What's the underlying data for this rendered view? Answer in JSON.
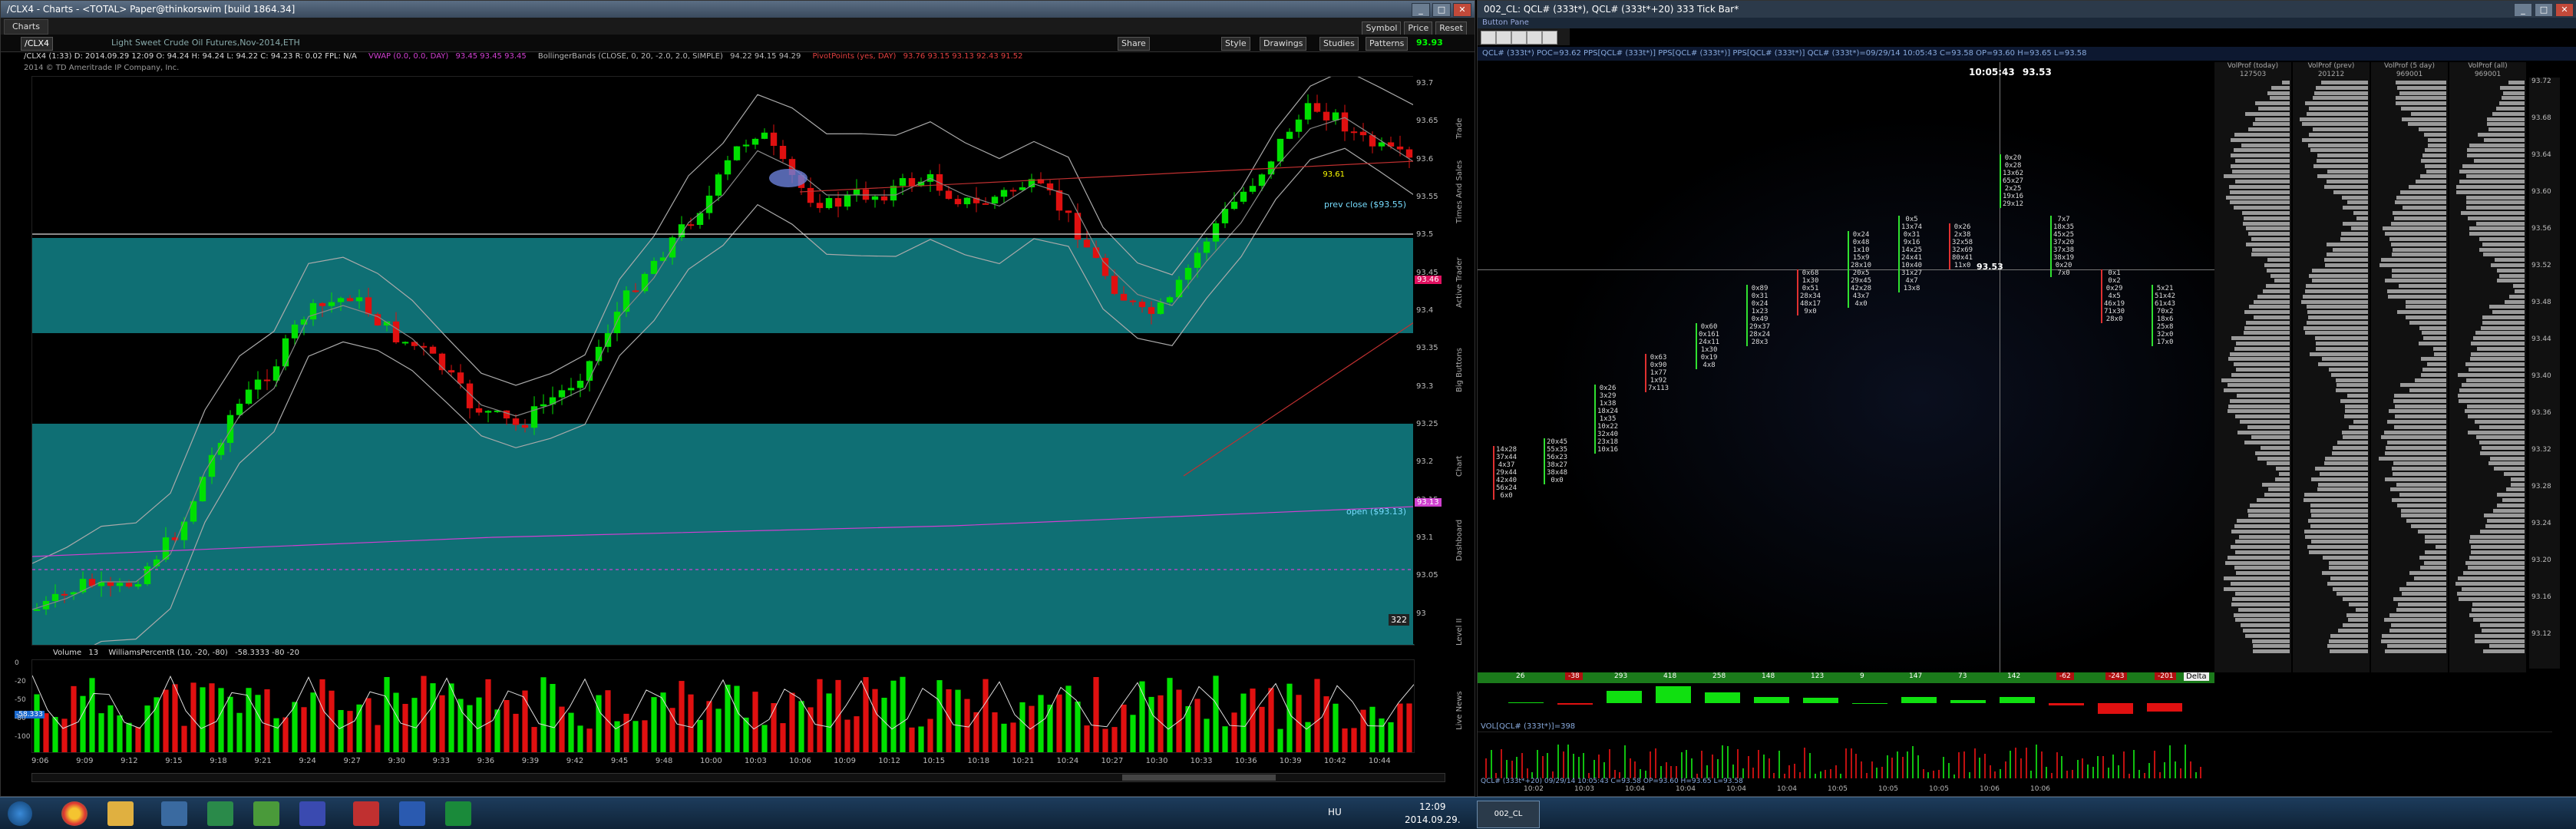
{
  "left_window": {
    "title": "/CLX4 - Charts - <TOTAL> Paper@thinkorswim [build 1864.34]",
    "tab": "Charts",
    "symbol": "/CLX4",
    "symbol_desc": "Light Sweet Crude Oil Futures,Nov-2014,ETH",
    "toolbar": [
      "Share",
      "Style",
      "Drawings",
      "Studies",
      "Patterns"
    ],
    "toolbar_right": [
      "Symbol",
      "Price",
      "Reset"
    ],
    "last_price": "93.93",
    "info_line": "/CLX4 (1:33)  D: 2014.09.29 12:09  O: 94.24  H: 94.24  L: 94.22  C: 94.23  R: 0.02  FPL: N/A",
    "vwap_label": "VWAP (0.0, 0.0, DAY)",
    "vwap_values": "93.45  93.45  93.45",
    "bollinger_label": "BollingerBands (CLOSE, 0, 20, -2.0, 2.0, SIMPLE)",
    "bollinger_values": "94.22  94.15  94.29",
    "pivot_label": "PivotPoints (yes, DAY)",
    "pivot_values": "93.76  93.15  93.13  92.43  91.52",
    "copyright": "2014 © TD Ameritrade IP Company, Inc.",
    "annotations": {
      "prev_close": "prev close ($93.55)",
      "open": "open ($93.13)",
      "bar_count": "322",
      "price_tag": "93.61"
    },
    "y_ticks": [
      "93.7",
      "93.65",
      "93.6",
      "93.55",
      "93.5",
      "93.45",
      "93.4",
      "93.35",
      "93.3",
      "93.25",
      "93.2",
      "93.15",
      "93.1",
      "93.05",
      "93"
    ],
    "right_tags": {
      "tag1": "93.46",
      "tag2": "93.13"
    },
    "side_tabs": [
      "Trade",
      "Times And Sales",
      "Active Trader",
      "Big Buttons",
      "Chart",
      "Dashboard",
      "Level II",
      "Live News"
    ],
    "lower_study": {
      "label": "Volume",
      "value": "13",
      "williams": "WilliamsPercentR (10, -20, -80)",
      "williams_vals": "-58.3333  -80  -20",
      "y_labels": [
        "0",
        "-20",
        "-50",
        "-80",
        "-100"
      ],
      "left_tag": "-58.333"
    },
    "time_ticks": [
      "9:06",
      "9:09",
      "9:12",
      "9:15",
      "9:18",
      "9:21",
      "9:24",
      "9:27",
      "9:30",
      "9:33",
      "9:36",
      "9:39",
      "9:42",
      "9:45",
      "9:48",
      "10:00",
      "10:03",
      "10:06",
      "10:09",
      "10:12",
      "10:15",
      "10:18",
      "10:21",
      "10:24",
      "10:27",
      "10:30",
      "10:33",
      "10:36",
      "10:39",
      "10:42",
      "10:44"
    ],
    "colors": {
      "up": "#00e000",
      "down": "#e01010",
      "band": "#0f6f74",
      "vwap": "#d040d0"
    }
  },
  "right_window": {
    "title": "002_CL: QCL# (333t*), QCL# (333t*+20) 333 Tick Bar*",
    "button_pane": "Button Pane",
    "info_strip": "QCL# (333t*) POC=93.62  PPS[QCL# (333t*)]  PPS[QCL# (333t*)]  PPS[QCL# (333t*)]  QCL# (333t*)=09/29/14 10:05:43 C=93.58 OP=93.60 H=93.65 L=93.58",
    "crosshair_time": "10:05:43",
    "crosshair_price": "93.53",
    "crosshair_price2": "93.53",
    "vol_profiles": [
      {
        "label": "VolProf (today)",
        "value": "127503"
      },
      {
        "label": "VolProf (prev)",
        "value": "201212"
      },
      {
        "label": "VolProf (5 day)",
        "value": "969001"
      },
      {
        "label": "VolProf (all)",
        "value": "969001"
      }
    ],
    "price_ticks": [
      "93.72",
      "93.68",
      "93.64",
      "93.60",
      "93.56",
      "93.52",
      "93.48",
      "93.44",
      "93.40",
      "93.36",
      "93.32",
      "93.28",
      "93.24",
      "93.20",
      "93.16",
      "93.12"
    ],
    "delta_label": "Delta",
    "delta_values": [
      "26",
      "-38",
      "293",
      "418",
      "258",
      "148",
      "123",
      "9",
      "147",
      "73",
      "142",
      "-62",
      "-243",
      "-201"
    ],
    "footprint_columns": [
      [
        "14x28",
        "37x44",
        "4x37",
        "29x44",
        "42x40",
        "56x24",
        "6x0"
      ],
      [
        "20x45",
        "55x35",
        "56x23",
        "38x27",
        "38x48",
        "0x0"
      ],
      [
        "0x26",
        "3x29",
        "1x38",
        "18x24",
        "1x35",
        "10x22",
        "32x40",
        "23x18",
        "10x16"
      ],
      [
        "0x63",
        "0x90",
        "1x77",
        "1x92",
        "7x113"
      ],
      [
        "0x60",
        "0x161",
        "24x11",
        "1x30",
        "0x19",
        "4x8"
      ],
      [
        "0x89",
        "0x31",
        "0x24",
        "1x23",
        "0x49",
        "29x37",
        "28x24",
        "28x3"
      ],
      [
        "0x68",
        "1x30",
        "0x51",
        "28x34",
        "48x17",
        "9x0"
      ],
      [
        "0x24",
        "0x48",
        "1x10",
        "15x9",
        "28x10",
        "20x5",
        "29x45",
        "42x28",
        "43x7",
        "4x0"
      ],
      [
        "0x5",
        "13x74",
        "0x31",
        "9x16",
        "14x25",
        "24x41",
        "10x40",
        "31x27",
        "4x7",
        "13x8"
      ],
      [
        "0x26",
        "2x38",
        "32x58",
        "32x69",
        "80x41",
        "11x0"
      ],
      [
        "0x20",
        "0x28",
        "13x62",
        "65x27",
        "2x25",
        "19x16",
        "29x12"
      ],
      [
        "7x7",
        "18x35",
        "45x25",
        "37x20",
        "37x38",
        "38x19",
        "0x20",
        "7x0"
      ],
      [
        "0x1",
        "0x2",
        "0x29",
        "4x5",
        "46x19",
        "71x30",
        "28x0"
      ],
      [
        "5x21",
        "51x42",
        "61x43",
        "70x2",
        "18x6",
        "25x8",
        "32x0",
        "17x0"
      ]
    ],
    "lower_label": "VOL[QCL# (333t*)]=398",
    "bottom_info": "QCL# (333t*+20) 09/29/14 10:05:43 C=93.58 OP=93.60 H=93.65 L=93.58",
    "time_ticks": [
      "10:02",
      "10:03",
      "10:04",
      "10:04",
      "10:04",
      "10:04",
      "10:05",
      "10:05",
      "10:05",
      "10:06",
      "10:06"
    ],
    "tab": "002_CL"
  },
  "taskbar": {
    "lang": "HU",
    "time": "12:09",
    "date": "2014.09.29."
  }
}
